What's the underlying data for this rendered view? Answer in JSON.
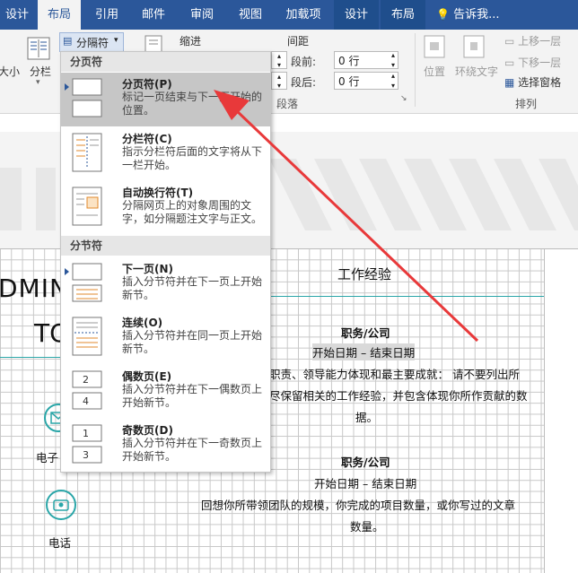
{
  "tabs": [
    {
      "label": "设计"
    },
    {
      "label": "布局"
    },
    {
      "label": "引用"
    },
    {
      "label": "邮件"
    },
    {
      "label": "审阅"
    },
    {
      "label": "视图"
    },
    {
      "label": "加载项"
    },
    {
      "label": "设计"
    },
    {
      "label": "布局"
    }
  ],
  "tell_me": "告诉我...",
  "ribbon": {
    "size": "大小",
    "columns": "分栏",
    "breaks_button": "分隔符",
    "indent": "缩进",
    "spacing": "间距",
    "before_label": "段前:",
    "after_label": "段后:",
    "before_value": "0 行",
    "after_value": "0 行",
    "paragraph_group": "段落",
    "position": "位置",
    "wrap_text": "环绕文字",
    "bring_forward": "上移一层",
    "send_backward": "下移一层",
    "selection_pane": "选择窗格",
    "arrange_group": "排列"
  },
  "menu": {
    "page_breaks_header": "分页符",
    "section_breaks_header": "分节符",
    "items": [
      {
        "title": "分页符(P)",
        "desc": "标记一页结束与下一页开始的位置。"
      },
      {
        "title": "分栏符(C)",
        "desc": "指示分栏符后面的文字将从下一栏开始。"
      },
      {
        "title": "自动换行符(T)",
        "desc": "分隔网页上的对象周围的文字，如分隔题注文字与正文。"
      },
      {
        "title": "下一页(N)",
        "desc": "插入分节符并在下一页上开始新节。"
      },
      {
        "title": "连续(O)",
        "desc": "插入分节符并在同一页上开始新节。"
      },
      {
        "title": "偶数页(E)",
        "desc": "插入分节符并在下一偶数页上开始新节。"
      },
      {
        "title": "奇数页(D)",
        "desc": "插入分节符并在下一奇数页上开始新节。"
      }
    ]
  },
  "document": {
    "left_big_1": "DMIN",
    "left_big_2": "TO",
    "section_title": "工作经验",
    "job1_title": "职务/公司",
    "job1_dates": "开始日期 – 结束日期",
    "job1_body_1": "职责、领导能力体现和最主要成就： 请不要列出所",
    "job1_body_2": "尽保留相关的工作经验，并包含体现你所作贡献的数",
    "job1_body_3": "据。",
    "job2_title": "职务/公司",
    "job2_dates": "开始日期 – 结束日期",
    "job2_body_1": "回想你所带领团队的规模，你完成的项目数量，或你写过的文章",
    "job2_body_2": "数量。",
    "email_label": "电子",
    "phone_label": "电话"
  },
  "colors": {
    "tab_bar": "#2b579a",
    "accent_teal": "#2aa6a8",
    "arrow": "#e8393a",
    "highlight": "#c6c6c6"
  }
}
